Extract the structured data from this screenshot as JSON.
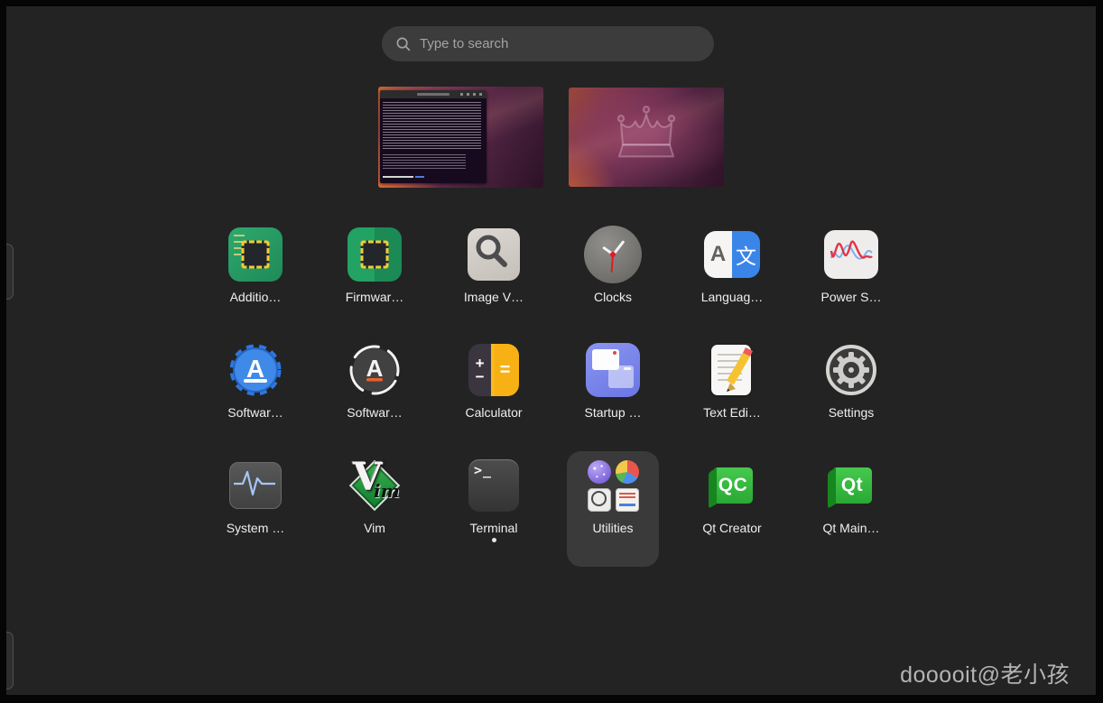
{
  "screen": {
    "background": "#232323",
    "frame": "#000000"
  },
  "search": {
    "placeholder": "Type to search",
    "icon": "search-icon"
  },
  "workspaces": [
    {
      "name": "workspace-1",
      "content": "terminal window over purple Ubuntu wallpaper"
    },
    {
      "name": "workspace-2",
      "content": "purple Ubuntu wallpaper with faded crown emblem"
    }
  ],
  "apps": [
    {
      "label": "Additio…",
      "icon": "additional-drivers-icon"
    },
    {
      "label": "Firmwar…",
      "icon": "firmware-updater-icon"
    },
    {
      "label": "Image V…",
      "icon": "image-viewer-icon"
    },
    {
      "label": "Clocks",
      "icon": "clocks-icon"
    },
    {
      "label": "Languag…",
      "icon": "language-support-icon",
      "letter_a": "A",
      "letter_zh": "文"
    },
    {
      "label": "Power S…",
      "icon": "power-statistics-icon"
    },
    {
      "label": "Softwar…",
      "icon": "software-store-icon",
      "letter": "A"
    },
    {
      "label": "Softwar…",
      "icon": "software-updater-icon",
      "letter": "A"
    },
    {
      "label": "Calculator",
      "icon": "calculator-icon",
      "plus": "+",
      "minus": "−",
      "equals": "="
    },
    {
      "label": "Startup …",
      "icon": "startup-applications-icon"
    },
    {
      "label": "Text Edi…",
      "icon": "text-editor-icon"
    },
    {
      "label": "Settings",
      "icon": "settings-icon"
    },
    {
      "label": "System …",
      "icon": "system-monitor-icon"
    },
    {
      "label": "Vim",
      "icon": "vim-icon",
      "letter_v": "V",
      "letter_im": "im"
    },
    {
      "label": "Terminal",
      "icon": "terminal-icon",
      "prompt": ">_",
      "running": true
    },
    {
      "label": "Utilities",
      "icon": "utilities-folder-icon",
      "selected": true
    },
    {
      "label": "Qt Creator",
      "icon": "qt-creator-icon",
      "badge": "QC"
    },
    {
      "label": "Qt Main…",
      "icon": "qt-maintenance-icon",
      "badge": "Qt"
    }
  ],
  "watermark": {
    "text": "dooooit@老小孩"
  }
}
